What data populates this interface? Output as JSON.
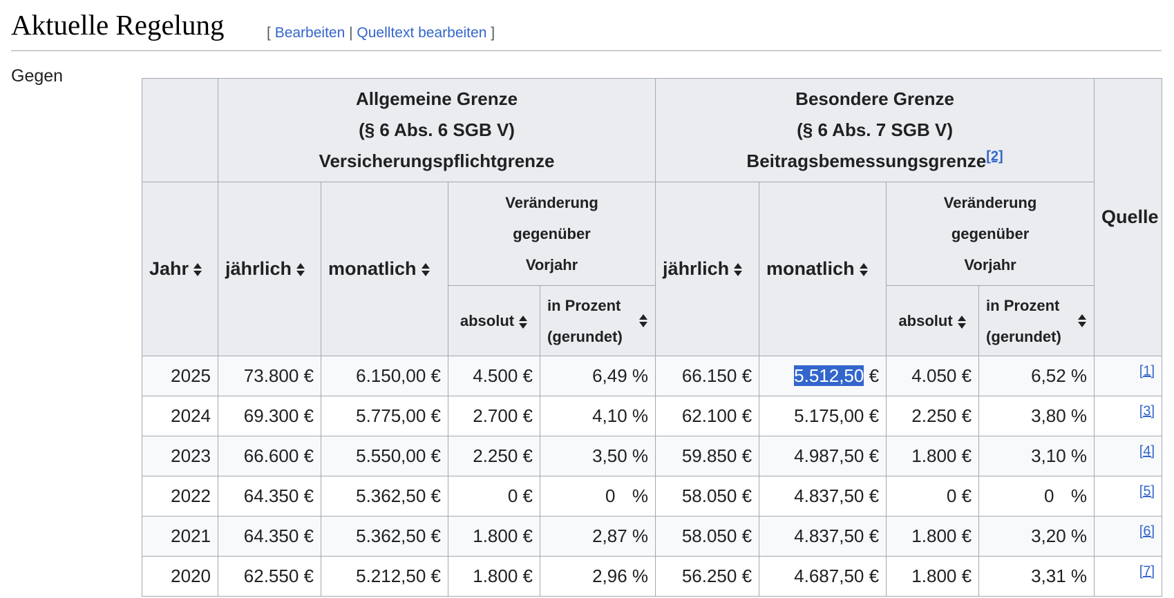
{
  "section": {
    "title": "Aktuelle Regelung",
    "edit_open": "[",
    "edit_link": "Bearbeiten",
    "edit_sep": "|",
    "source_link": "Quelltext bearbeiten",
    "edit_close": "]"
  },
  "intro": "Gegen",
  "table": {
    "group_general": {
      "line1": "Allgemeine Grenze",
      "line2": "(§ 6 Abs. 6 SGB V)",
      "line3": "Versicherungspflichtgrenze"
    },
    "group_special": {
      "line1": "Besondere Grenze",
      "line2": "(§ 6 Abs. 7 SGB V)",
      "line3": "Beitragsbemessungsgrenze",
      "ref": "[2]"
    },
    "col_year": "Jahr",
    "col_annual": "jährlich",
    "col_monthly": "monatlich",
    "col_change": {
      "line1": "Veränderung",
      "line2": "gegenüber",
      "line3": "Vorjahr"
    },
    "col_absolute": "absolut",
    "col_percent": {
      "line1": "in Prozent",
      "line2": "(gerundet)"
    },
    "col_source": "Quelle",
    "rows": [
      {
        "year": "2025",
        "g_annual": "73.800 €",
        "g_monthly": "6.150,00 €",
        "g_abs": "4.500 €",
        "g_pct": "6,49 %",
        "s_annual": "66.150 €",
        "s_monthly_selected": "5.512,50",
        "s_monthly_rest": " €",
        "s_abs": "4.050 €",
        "s_pct": "6,52 %",
        "ref": "[1]"
      },
      {
        "year": "2024",
        "g_annual": "69.300 €",
        "g_monthly": "5.775,00 €",
        "g_abs": "2.700 €",
        "g_pct": "4,10 %",
        "s_annual": "62.100 €",
        "s_monthly": "5.175,00 €",
        "s_abs": "2.250 €",
        "s_pct": "3,80 %",
        "ref": "[3]"
      },
      {
        "year": "2023",
        "g_annual": "66.600 €",
        "g_monthly": "5.550,00 €",
        "g_abs": "2.250 €",
        "g_pct": "3,50 %",
        "s_annual": "59.850 €",
        "s_monthly": "4.987,50 €",
        "s_abs": "1.800 €",
        "s_pct": "3,10 %",
        "ref": "[4]"
      },
      {
        "year": "2022",
        "g_annual": "64.350 €",
        "g_monthly": "5.362,50 €",
        "g_abs": "0 €",
        "g_pct_num": "0",
        "g_pct_unit": "%",
        "s_annual": "58.050 €",
        "s_monthly": "4.837,50 €",
        "s_abs": "0 €",
        "s_pct_num": "0",
        "s_pct_unit": "%",
        "ref": "[5]"
      },
      {
        "year": "2021",
        "g_annual": "64.350 €",
        "g_monthly": "5.362,50 €",
        "g_abs": "1.800 €",
        "g_pct": "2,87 %",
        "s_annual": "58.050 €",
        "s_monthly": "4.837,50 €",
        "s_abs": "1.800 €",
        "s_pct": "3,20 %",
        "ref": "[6]"
      },
      {
        "year": "2020",
        "g_annual": "62.550 €",
        "g_monthly": "5.212,50 €",
        "g_abs": "1.800 €",
        "g_pct": "2,96 %",
        "s_annual": "56.250 €",
        "s_monthly": "4.687,50 €",
        "s_abs": "1.800 €",
        "s_pct": "3,31 %",
        "ref": "[7]"
      }
    ]
  }
}
